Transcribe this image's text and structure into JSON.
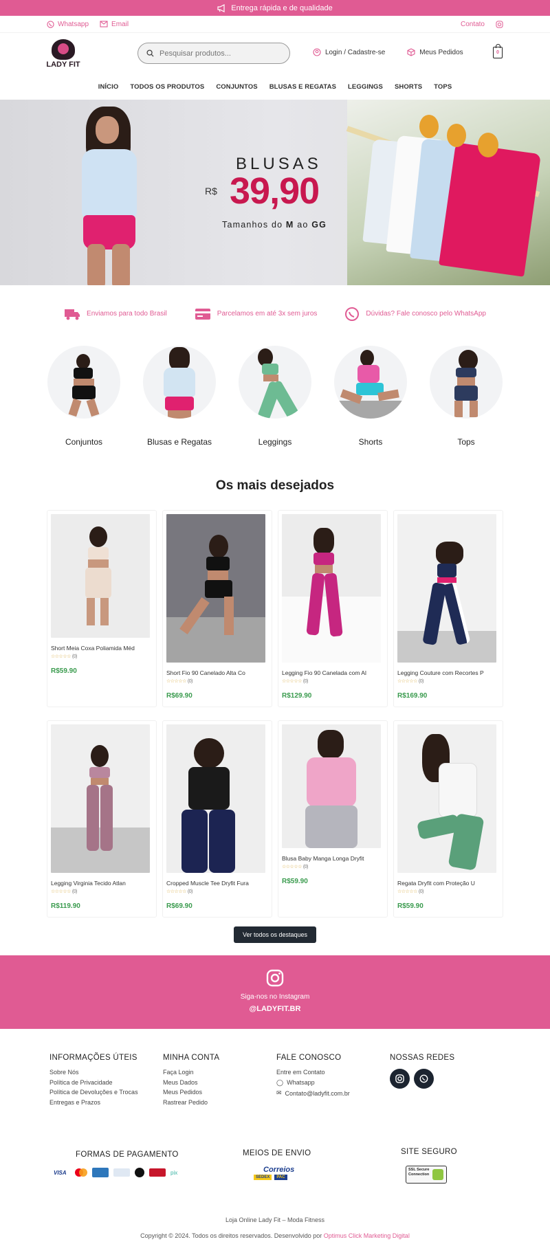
{
  "colors": {
    "accent": "#e05b93",
    "price": "#3a9b4e",
    "dark": "#222a33",
    "hero_price": "#c8184f"
  },
  "topbar": {
    "text": "Entrega rápida e de qualidade",
    "icon": "megaphone-icon"
  },
  "contactbar": {
    "whatsapp": "Whatsapp",
    "email": "Email",
    "contact": "Contato"
  },
  "header": {
    "logo_text": "LADY FIT",
    "search_placeholder": "Pesquisar produtos...",
    "login": "Login / Cadastre-se",
    "orders": "Meus Pedidos",
    "cart_count": "0"
  },
  "nav": [
    "INÍCIO",
    "TODOS OS PRODUTOS",
    "CONJUNTOS",
    "BLUSAS E REGATAS",
    "LEGGINGS",
    "SHORTS",
    "TOPS"
  ],
  "hero": {
    "title": "BLUSAS",
    "currency": "R$",
    "price": "39,90",
    "sizes_pre": "Tamanhos do ",
    "size_a": "M",
    "sizes_mid": " ao ",
    "size_b": "GG"
  },
  "features": [
    "Enviamos para todo Brasil",
    "Parcelamos em até 3x sem juros",
    "Dúvidas? Fale conosco pelo WhatsApp"
  ],
  "categories": [
    "Conjuntos",
    "Blusas e Regatas",
    "Leggings",
    "Shorts",
    "Tops"
  ],
  "featured": {
    "title": "Os mais desejados",
    "products": [
      {
        "name": "Short Meia Coxa Poliamida Méd",
        "reviews": "(0)",
        "price": "R$59.90"
      },
      {
        "name": "Short Fio 90 Canelado Alta Co",
        "reviews": "(0)",
        "price": "R$69.90"
      },
      {
        "name": "Legging Fio 90 Canelada com Al",
        "reviews": "(0)",
        "price": "R$129.90"
      },
      {
        "name": "Legging Couture com Recortes P",
        "reviews": "(0)",
        "price": "R$169.90"
      },
      {
        "name": "Legging Virginia Tecido Atlan",
        "reviews": "(0)",
        "price": "R$119.90"
      },
      {
        "name": "Cropped Muscle Tee Dryfit Fura",
        "reviews": "(0)",
        "price": "R$69.90"
      },
      {
        "name": "Blusa Baby Manga Longa Dryfit",
        "reviews": "(0)",
        "price": "R$59.90"
      },
      {
        "name": "Regata Dryfit com Proteção U",
        "reviews": "(0)",
        "price": "R$59.90"
      }
    ],
    "button": "Ver todos os destaques"
  },
  "instagram": {
    "follow": "Siga-nos no Instagram",
    "handle": "@LADYFIT.BR"
  },
  "footer": {
    "info": {
      "title": "INFORMAÇÕES ÚTEIS",
      "links": [
        "Sobre Nós",
        "Política de Privacidade",
        "Política de Devoluções e Trocas",
        "Entregas e Prazos"
      ]
    },
    "account": {
      "title": "MINHA CONTA",
      "links": [
        "Faça Login",
        "Meus Dados",
        "Meus Pedidos",
        "Rastrear Pedido"
      ]
    },
    "contact": {
      "title": "FALE CONOSCO",
      "links": [
        "Entre em Contato",
        "Whatsapp",
        "Contato@ladyfit.com.br"
      ]
    },
    "social": {
      "title": "NOSSAS REDES"
    },
    "payments": {
      "title": "FORMAS DE PAGAMENTO",
      "methods": [
        "VISA",
        "mastercard",
        "amex",
        "diners",
        "elo",
        "hipercard",
        "pix"
      ]
    },
    "shipping": {
      "title": "MEIOS DE ENVIO",
      "carrier": "Correios",
      "services": [
        "SEDEX",
        "PAC"
      ]
    },
    "secure": {
      "title": "SITE SEGURO",
      "badge": "SSL Secure Connection"
    },
    "store_line": "Loja Online Lady Fit – Moda Fitness",
    "copyright": "Copyright © 2024. Todos os direitos reservados. Desenvolvido por",
    "developer": "Optimus Click Marketing Digital"
  }
}
